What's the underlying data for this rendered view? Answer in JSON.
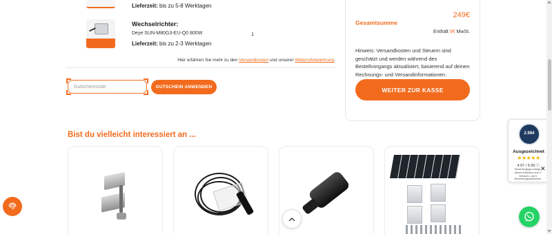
{
  "cart": {
    "items": [
      {
        "delivery_label": "Lieferzeit:",
        "delivery_value": "bis zu 5-8 Werktagen"
      },
      {
        "category": "Wechselrichter:",
        "model": "Deye SUN-M80G3-EU-Q0 800W",
        "quantity": "1",
        "delivery_label": "Lieferzeit:",
        "delivery_value": "bis zu 2-3 Werktagen"
      }
    ],
    "info": {
      "prefix": "Hier erfahren Sie mehr zu den",
      "link1": "Versandkosten",
      "middle": "und unserer",
      "link2": "Widerrufsbelehrung",
      "suffix": "."
    },
    "coupon": {
      "placeholder": "Gutscheincode",
      "button_label": "GUTSCHEIN ANWENDEN"
    }
  },
  "summary": {
    "total_label": "Gesamtsumme",
    "total_value": "249€",
    "tax_prefix": "Enthält",
    "tax_amount": "0€",
    "tax_suffix": "MwSt.",
    "hint": "Hinweis: Versandkosten und Steuern sind geschätzt und werden während des Bestellvorgangs aktualisiert, basierend auf deinen Rechnungs- und Versandinformationen.",
    "checkout_label": "WEITER ZUR KASSE"
  },
  "recommendations": {
    "heading": "Bist du vielleicht interessiert an ..."
  },
  "trust_badge": {
    "count": "2.984",
    "title": "Ausgezeichnet",
    "stars": "★★★★★",
    "score": "4.97 / 5.00",
    "note": "Bewertungsgrundlage: dieses Anbieters sind 2 Verkaufs- und 0 Bewertungsplattformen",
    "close": "✕"
  },
  "colors": {
    "accent": "#f26b1d",
    "whatsapp": "#25d366",
    "star": "#f5b400"
  },
  "icons": [
    "fingerprint-icon",
    "whatsapp-icon",
    "chevron-up-icon",
    "close-icon",
    "info-icon"
  ]
}
